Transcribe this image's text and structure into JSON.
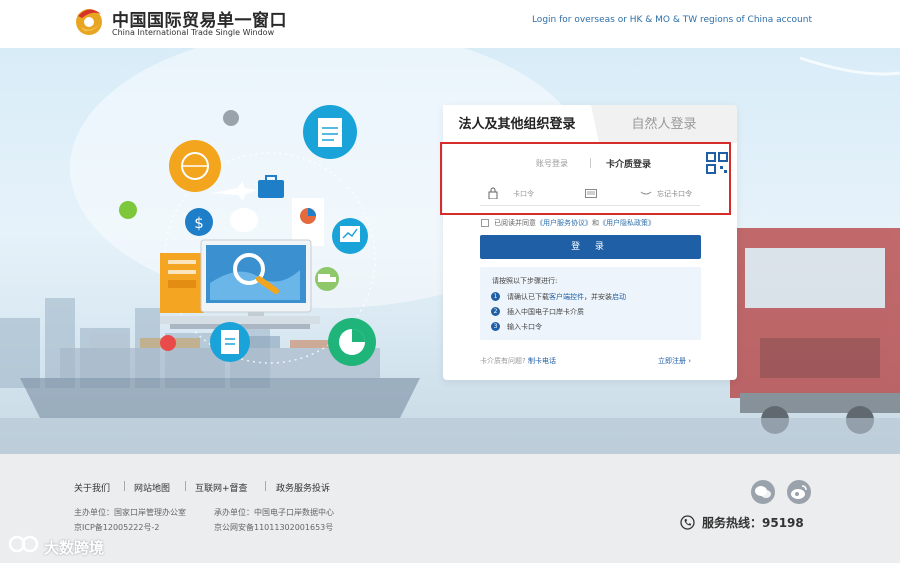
{
  "header": {
    "title_cn": "中国国际贸易单一窗口",
    "title_en": "China International Trade Single Window",
    "overseas_link": "Login for overseas or HK & MO & TW regions of China account"
  },
  "login": {
    "tabs": [
      "法人及其他组织登录",
      "自然人登录"
    ],
    "sub_tabs": [
      "账号登录",
      "卡介质登录"
    ],
    "pin_placeholder": "卡口令",
    "forgot": "忘记卡口令",
    "agree_prefix": "已阅读并同意",
    "agree_link1": "《用户服务协议》",
    "agree_and": "和",
    "agree_link2": "《用户隐私政策》",
    "login_button": "登 录",
    "steps_title": "请按照以下步骤进行:",
    "steps": [
      {
        "num": "1",
        "pre": "请确认已下载",
        "link": "客户端控件",
        "mid": "，并安装",
        "link2": "启动"
      },
      {
        "num": "2",
        "text": "插入中国电子口岸卡介质"
      },
      {
        "num": "3",
        "text": "输入卡口令"
      }
    ],
    "problem_text": "卡介质有问题?",
    "problem_link": "制卡电话",
    "register": "立即注册 ›"
  },
  "footer": {
    "links": [
      "关于我们",
      "网站地图",
      "互联网+督查",
      "政务服务投诉"
    ],
    "sponsor": "主办单位：国家口岸管理办公室",
    "organizer": "承办单位：中国电子口岸数据中心",
    "icp": "京ICP备12005222号-2",
    "police": "京公网安备11011302001653号",
    "hotline": "服务热线：95198"
  },
  "watermark": "大数跨境",
  "colors": {
    "primary": "#1e5fa5",
    "highlight_box": "#d62c2c",
    "footer_bg": "#ebedef"
  }
}
